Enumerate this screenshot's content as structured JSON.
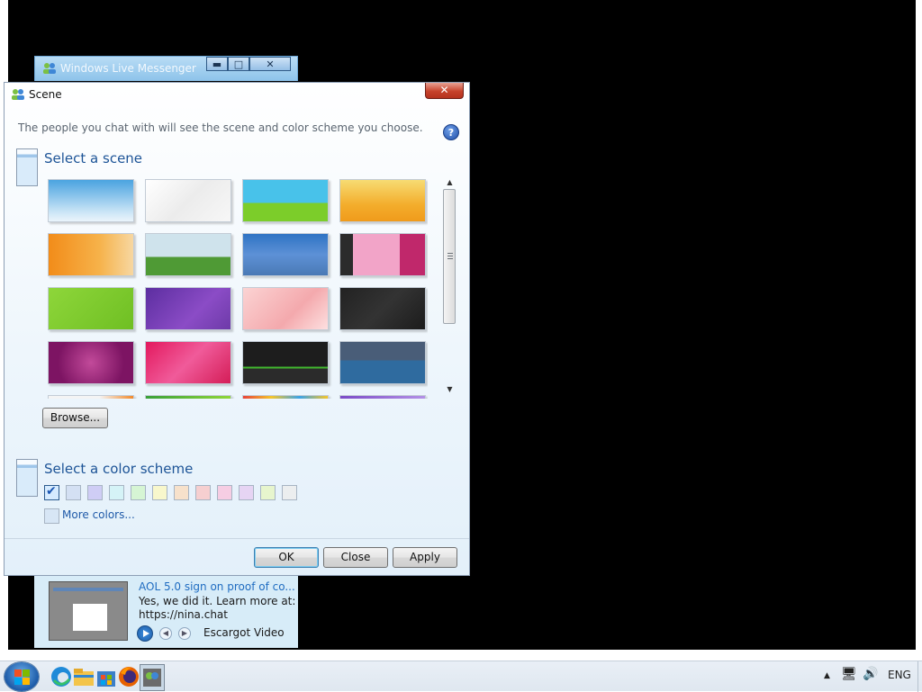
{
  "messenger": {
    "title": "Windows Live Messenger",
    "controls": {
      "minimize": "▬",
      "maximize": "□",
      "close": "✕"
    },
    "ad": {
      "title": "AOL 5.0 sign on proof of co...",
      "line1": "Yes, we did it. Learn more at:",
      "line2": "https://nina.chat",
      "source": "Escargot Video",
      "prev": "◀",
      "next": "▶"
    }
  },
  "dialog": {
    "title": "Scene",
    "close_symbol": "✕",
    "description": "The people you chat with will see the scene and color scheme you choose.",
    "help_symbol": "?",
    "scene_heading": "Select a scene",
    "scenes": [
      {
        "name": "sky-blue",
        "bg": "linear-gradient(#4aa3e0,#cfe7f7 80%,#eaf4fb)"
      },
      {
        "name": "white-clouds",
        "bg": "linear-gradient(135deg,#ffffff,#ececec 50%,#f7f7f7)"
      },
      {
        "name": "green-hill",
        "bg": "linear-gradient(#48c2ea 0 55%,#7ccd2a 55% 100%)"
      },
      {
        "name": "orange-tree",
        "bg": "linear-gradient(#f7dc73,#f3ad2c 60%,#f09b1b)"
      },
      {
        "name": "orange-grass",
        "bg": "linear-gradient(90deg,#f28c19,#f6b24a 60%,#f7d7a1)"
      },
      {
        "name": "meadow",
        "bg": "linear-gradient(#cfe3ec 0 55%,#4f9a35 55% 100%)"
      },
      {
        "name": "blue-hills",
        "bg": "linear-gradient(#2e73c4,#5d91d6 50%,#4a79b5)"
      },
      {
        "name": "pink-pattern",
        "bg": "linear-gradient(90deg,#2b2b2b 0 15%,#f2a4c8 15% 70%,#c0286b 70%)"
      },
      {
        "name": "lime-green",
        "bg": "linear-gradient(135deg,#8ed63a,#6fbf23)"
      },
      {
        "name": "purple-swirl",
        "bg": "linear-gradient(135deg,#5c2ea0,#8b4cc6 60%,#6d3aa8)"
      },
      {
        "name": "pink-blossom",
        "bg": "linear-gradient(135deg,#fbd3d3,#f4a9ad 60%,#fde0e0)"
      },
      {
        "name": "dark-hex",
        "bg": "linear-gradient(135deg,#222,#333 50%,#1c1c1c)"
      },
      {
        "name": "magenta-heart",
        "bg": "radial-gradient(circle,#c24a9a,#7d1463 70%)"
      },
      {
        "name": "pink-waves",
        "bg": "linear-gradient(135deg,#e3195e,#f05b9a 50%,#d41d57)"
      },
      {
        "name": "dark-streak",
        "bg": "linear-gradient(#1d1d1d 0 60%,#41b72e 60% 64%,#2b2b2b 64%)"
      },
      {
        "name": "ocean-dolphin",
        "bg": "linear-gradient(#495d78 0 45%,#2f6b9f 45% 100%)"
      },
      {
        "name": "row5-1",
        "bg": "linear-gradient(90deg,#f4f4f4 60%,#f28a2c)"
      },
      {
        "name": "row5-2",
        "bg": "linear-gradient(90deg,#3aa03a,#8ed63a)"
      },
      {
        "name": "row5-3",
        "bg": "linear-gradient(90deg,#e8433b,#f4c52b,#3ba3e8,#f4c52b)"
      },
      {
        "name": "row5-4",
        "bg": "linear-gradient(90deg,#7b4bc7,#b391e6)"
      }
    ],
    "browse_label": "Browse...",
    "scroll_up": "▲",
    "scroll_down": "▼",
    "color_heading": "Select a color scheme",
    "colors": [
      "#d6ebff",
      "#d4e0f3",
      "#cfcdf5",
      "#d5f3f7",
      "#d6f5d4",
      "#f8f7cc",
      "#f7e1cb",
      "#f6cfd0",
      "#f6cde3",
      "#e6d4f3",
      "#e7f5cd",
      "#eceeef"
    ],
    "more_colors": "More colors...",
    "ok_label": "OK",
    "close_label": "Close",
    "apply_label": "Apply"
  },
  "taskbar": {
    "tray_arrow": "▲",
    "network": "🖥",
    "volume": "🔊",
    "language": "ENG"
  }
}
